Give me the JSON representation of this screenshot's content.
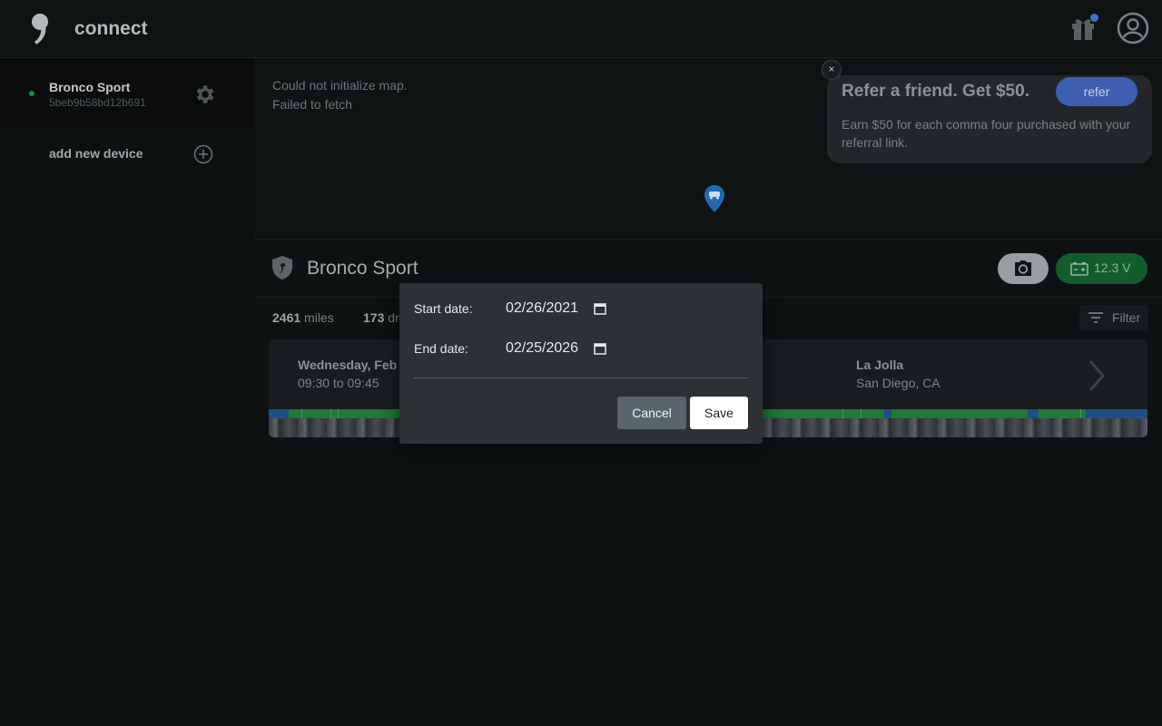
{
  "header": {
    "app_title": "connect",
    "logo_icon": "comma-logo-icon",
    "gift_icon": "gift-icon",
    "account_icon": "account-circle-icon",
    "notification_color": "#3d6fd9"
  },
  "sidebar": {
    "devices": [
      {
        "name": "Bronco Sport",
        "id": "5beb9b58bd12b691",
        "status_color": "#1a8a3a"
      }
    ],
    "add_device_label": "add new device"
  },
  "map": {
    "error_line1": "Could not initialize map.",
    "error_line2": "Failed to fetch"
  },
  "referral": {
    "title": "Refer a friend. Get $50.",
    "button_label": "refer",
    "body": "Earn $50 for each comma four purchased with your referral link.",
    "close_label": "×"
  },
  "device_bar": {
    "title": "Bronco Sport",
    "voltage": "12.3 V"
  },
  "stats": {
    "miles_value": "2461",
    "miles_unit": "miles",
    "drives_value": "173",
    "drives_unit": "dr"
  },
  "filter": {
    "label": "Filter"
  },
  "drive": {
    "date": "Wednesday, Feb",
    "time": "09:30 to 09:45",
    "destination": "La Jolla",
    "region": "San Diego, CA"
  },
  "dialog": {
    "start_label": "Start date:",
    "start_value": "02/26/2021",
    "end_label": "End date:",
    "end_value": "02/25/2026",
    "cancel_label": "Cancel",
    "save_label": "Save"
  },
  "colors": {
    "accent_blue": "#3d5fb0",
    "voltage_green": "#135c2c",
    "timeline_green": "#1e7a35",
    "timeline_blue": "#1f4f86"
  }
}
